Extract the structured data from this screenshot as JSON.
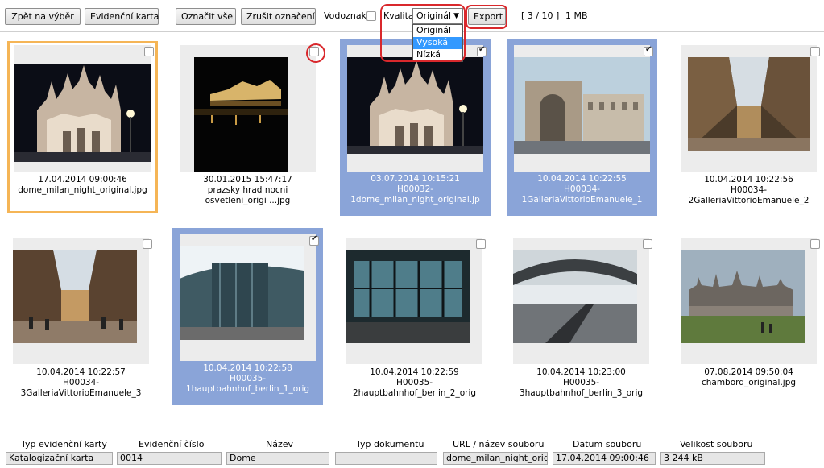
{
  "toolbar": {
    "back_label": "Zpět na výběr",
    "card_label": "Evidenční karta",
    "select_all_label": "Označit vše",
    "deselect_label": "Zrušit označení",
    "watermark_label": "Vodoznak",
    "quality_label": "Kvalita",
    "quality_selected": "Originál",
    "quality_options": [
      "Originál",
      "Vysoká",
      "Nízká"
    ],
    "quality_highlighted": "Vysoká",
    "export_label": "Export",
    "counter": "[ 3 / 10 ]",
    "size": "1 MB"
  },
  "gallery": [
    {
      "date": "17.04.2014 09:00:46",
      "name1": "dome_milan_night_original.jpg",
      "name2": "",
      "checked": false,
      "selected": false,
      "active": true
    },
    {
      "date": "30.01.2015 15:47:17",
      "name1": "prazsky hrad nocni",
      "name2": "osvetleni_origi ...jpg",
      "checked": false,
      "selected": false,
      "active": false
    },
    {
      "date": "03.07.2014 10:15:21",
      "name1": "H00032-",
      "name2": "1dome_milan_night_original.jp",
      "checked": true,
      "selected": true,
      "active": false
    },
    {
      "date": "10.04.2014 10:22:55",
      "name1": "H00034-",
      "name2": "1GalleriaVittorioEmanuele_1",
      "checked": true,
      "selected": true,
      "active": false
    },
    {
      "date": "10.04.2014 10:22:56",
      "name1": "H00034-",
      "name2": "2GalleriaVittorioEmanuele_2",
      "checked": false,
      "selected": false,
      "active": false
    },
    {
      "date": "10.04.2014 10:22:57",
      "name1": "H00034-",
      "name2": "3GalleriaVittorioEmanuele_3",
      "checked": false,
      "selected": false,
      "active": false
    },
    {
      "date": "10.04.2014 10:22:58",
      "name1": "H00035-",
      "name2": "1hauptbahnhof_berlin_1_orig",
      "checked": true,
      "selected": true,
      "active": false
    },
    {
      "date": "10.04.2014 10:22:59",
      "name1": "H00035-",
      "name2": "2hauptbahnhof_berlin_2_orig",
      "checked": false,
      "selected": false,
      "active": false
    },
    {
      "date": "10.04.2014 10:23:00",
      "name1": "H00035-",
      "name2": "3hauptbahnhof_berlin_3_orig",
      "checked": false,
      "selected": false,
      "active": false
    },
    {
      "date": "07.08.2014 09:50:04",
      "name1": "chambord_original.jpg",
      "name2": "",
      "checked": false,
      "selected": false,
      "active": false
    }
  ],
  "info": {
    "headers": [
      "Typ evidenční karty",
      "Evidenční číslo",
      "Název",
      "Typ dokumentu",
      "URL / název souboru",
      "Datum souboru",
      "Velikost souboru"
    ],
    "values": [
      "Katalogizační karta",
      "0014",
      "Dome",
      "",
      "dome_milan_night_origir",
      "17.04.2014 09:00:46",
      "3 244 kB"
    ]
  },
  "colors": {
    "selected_bg": "#8aa4d8",
    "active_border": "#f5b556",
    "annotation_red": "#d9282c",
    "dropdown_highlight": "#3399ff"
  }
}
